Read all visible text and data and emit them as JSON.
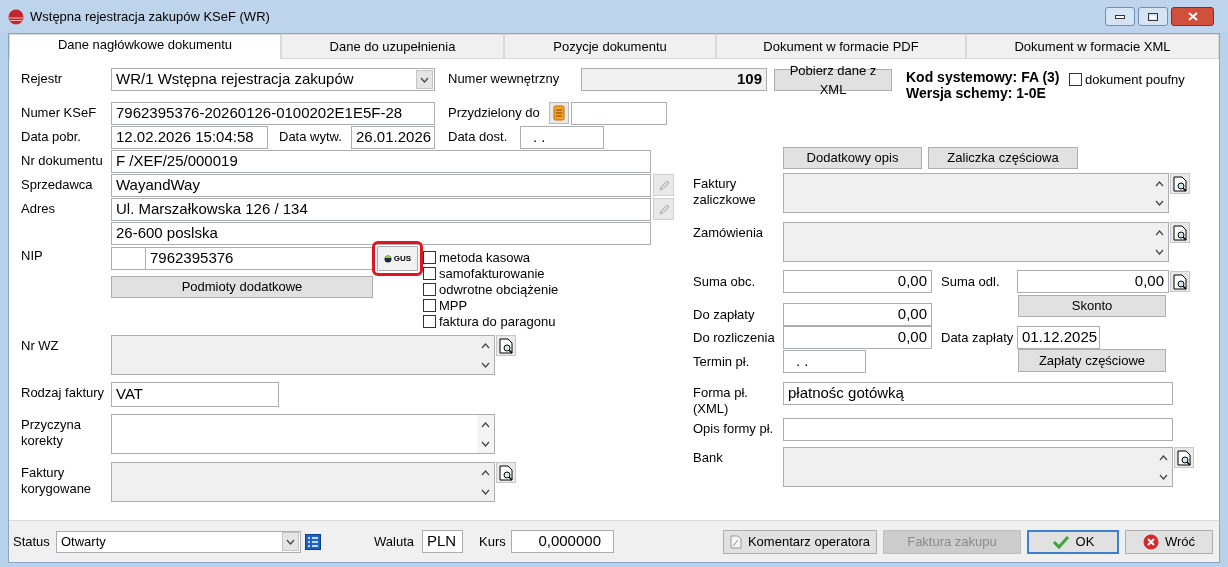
{
  "window": {
    "title": "Wstępna rejestracja zakupów KSeF (WR)"
  },
  "tabs": [
    {
      "label": "Dane nagłówkowe dokumentu",
      "selected": true
    },
    {
      "label": "Dane do uzupełnienia",
      "selected": false
    },
    {
      "label": "Pozycje dokumentu",
      "selected": false
    },
    {
      "label": "Dokument w formacie PDF",
      "selected": false
    },
    {
      "label": "Dokument w formacie XML",
      "selected": false
    }
  ],
  "header": {
    "rejestr": {
      "label": "Rejestr",
      "value": "WR/1 Wstępna rejestracja zakupów"
    },
    "numer_wewnetrzny": {
      "label": "Numer wewnętrzny",
      "value": "109"
    },
    "pobierz_button": "Pobierz dane z XML",
    "kod_systemowy": "Kod systemowy: FA (3)",
    "wersja_schemy": "Wersja schemy: 1-0E",
    "poufny": {
      "label": "dokument poufny",
      "checked": false
    },
    "numer_ksef": {
      "label": "Numer KSeF",
      "value": "7962395376-20260126-0100202E1E5F-28"
    },
    "przydzielony_do": {
      "label": "Przydzielony do"
    },
    "data_pobr": {
      "label": "Data pobr.",
      "value": "12.02.2026 15:04:58"
    },
    "data_wytw": {
      "label": "Data wytw.",
      "value": "26.01.2026"
    },
    "data_dost": {
      "label": "Data dost.",
      "value": ". ."
    }
  },
  "left": {
    "nr_dokumentu": {
      "label": "Nr dokumentu",
      "value": "F /XEF/25/000019"
    },
    "sprzedawca": {
      "label": "Sprzedawca",
      "value": "WayandWay"
    },
    "adres": {
      "label": "Adres",
      "lines": [
        "Ul. Marszałkowska 126 / 134",
        "26-600 poslska"
      ]
    },
    "nip": {
      "label": "NIP",
      "value": "7962395376"
    },
    "gus": {
      "label": "GUS",
      "highlighted": true
    },
    "podmioty_button": "Podmioty dodatkowe",
    "checkboxes": [
      {
        "label": "metoda kasowa",
        "checked": false
      },
      {
        "label": "samofakturowanie",
        "checked": false
      },
      {
        "label": "odwrotne obciążenie",
        "checked": false
      },
      {
        "label": "MPP",
        "checked": false
      },
      {
        "label": "faktura do paragonu",
        "checked": false
      }
    ],
    "nr_wz": {
      "label": "Nr WZ",
      "disabled": true
    },
    "rodzaj_faktury": {
      "label": "Rodzaj faktury",
      "value": "VAT"
    },
    "przyczyna_korekty": {
      "label": "Przyczyna korekty",
      "disabled": false
    },
    "faktury_korygowane": {
      "label": "Faktury korygowane",
      "disabled": true
    }
  },
  "right": {
    "buttons": [
      "Dodatkowy opis",
      "Zaliczka częściowa"
    ],
    "faktury_zaliczkowe": {
      "label": "Faktury zaliczkowe",
      "disabled": true
    },
    "zamowienia": {
      "label": "Zamówienia",
      "disabled": true
    },
    "suma_obc": {
      "label": "Suma obc.",
      "value": "0,00"
    },
    "suma_odl": {
      "label": "Suma odl.",
      "value": "0,00"
    },
    "skonto_button": "Skonto",
    "do_zaplaty": {
      "label": "Do zapłaty",
      "value": "0,00"
    },
    "do_rozliczenia": {
      "label": "Do rozliczenia",
      "value": "0,00"
    },
    "data_zaplaty": {
      "label": "Data zapłaty",
      "value": "01.12.2025"
    },
    "termin_pl": {
      "label": "Termin pł.",
      "value": ". ."
    },
    "zaplaty_button": "Zapłaty częściowe",
    "forma_pl": {
      "label": "Forma pł.(XML)",
      "value": "płatnośc gotówką"
    },
    "opis_formy": {
      "label": "Opis formy pł."
    },
    "bank": {
      "label": "Bank",
      "disabled": true
    }
  },
  "footer": {
    "status": {
      "label": "Status",
      "value": "Otwarty"
    },
    "waluta": {
      "label": "Waluta",
      "value": "PLN"
    },
    "kurs": {
      "label": "Kurs",
      "value": "0,000000"
    },
    "buttons": [
      {
        "label": "Komentarz operatora",
        "kind": "comment",
        "disabled": false,
        "default": false
      },
      {
        "label": "Faktura zakupu",
        "kind": "plain",
        "disabled": true,
        "default": false
      },
      {
        "label": "OK",
        "kind": "ok",
        "disabled": false,
        "default": true
      },
      {
        "label": "Wróć",
        "kind": "cancel",
        "disabled": false,
        "default": false
      }
    ]
  }
}
